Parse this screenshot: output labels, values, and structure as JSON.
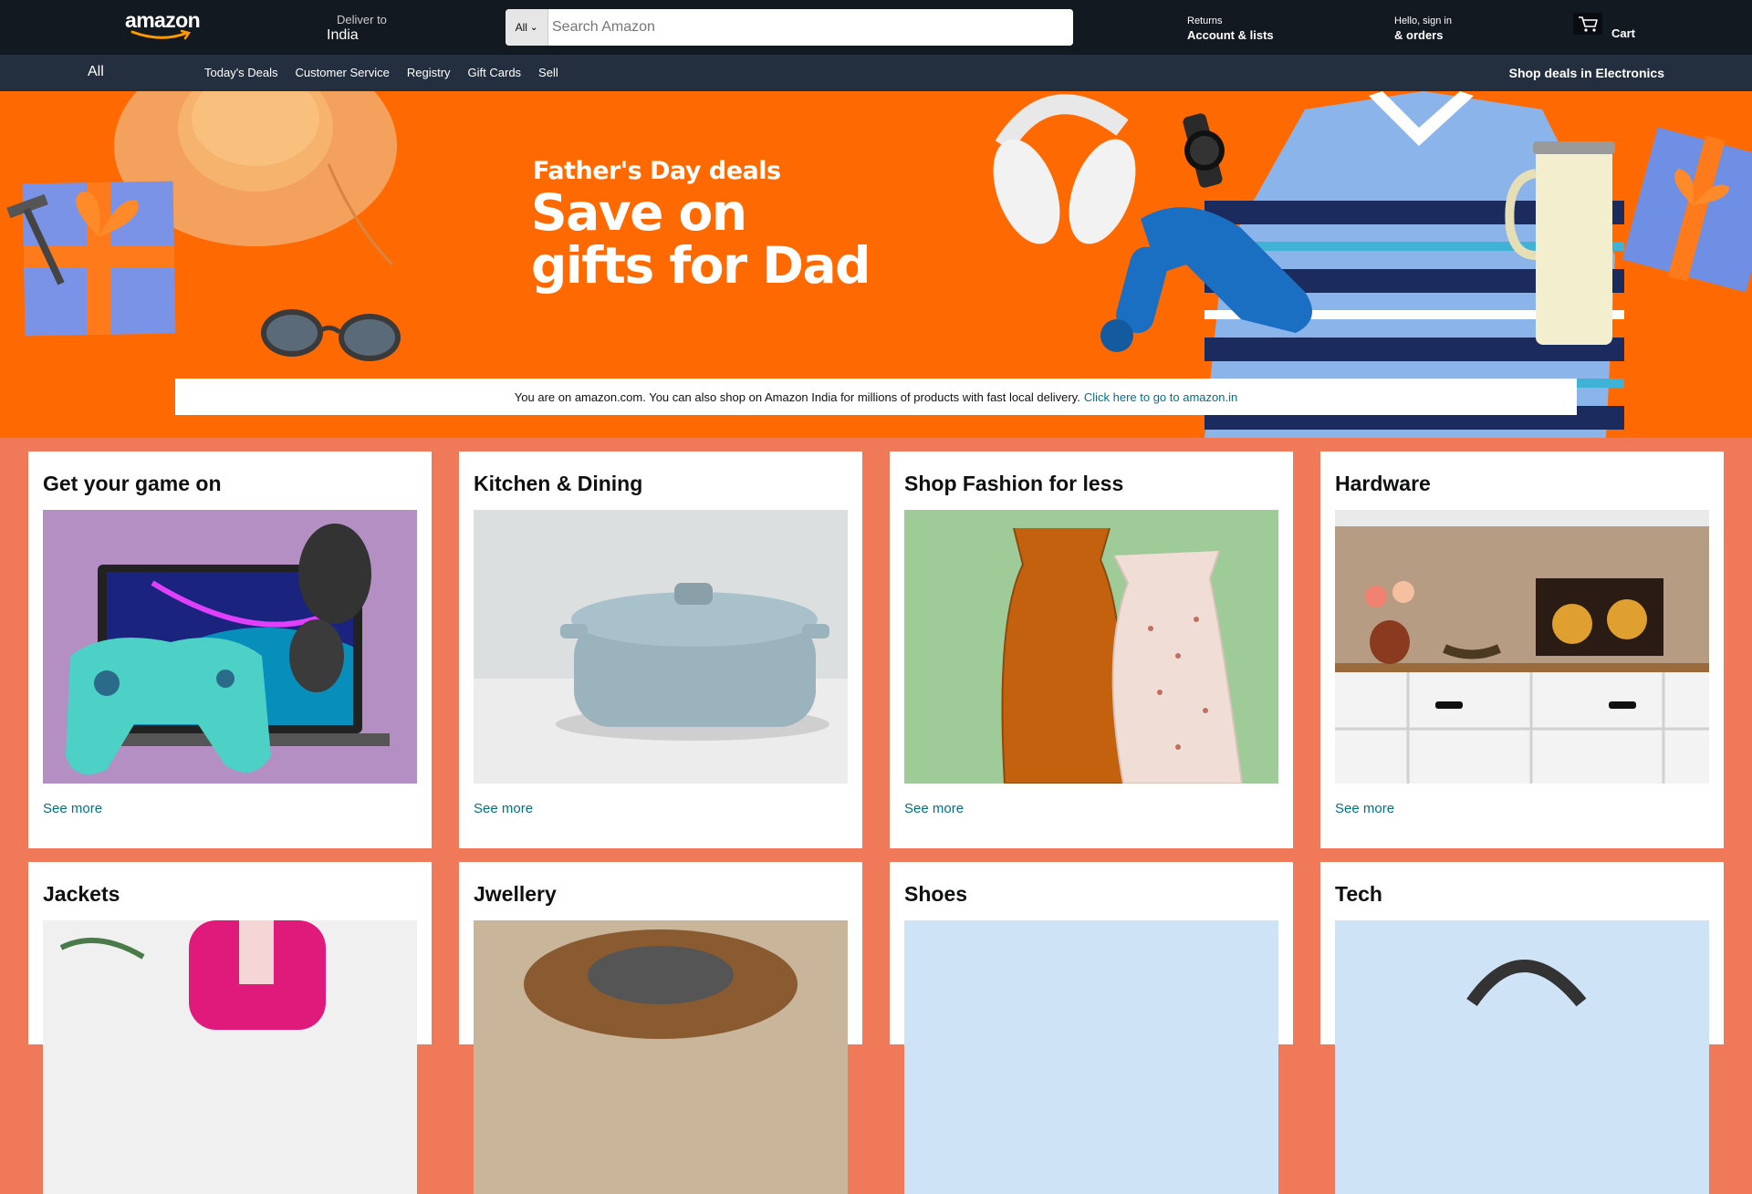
{
  "header": {
    "logo_text": "amazon",
    "deliver_to_label": "Deliver to",
    "deliver_to_location": "India",
    "search_category": "All",
    "search_placeholder": "Search Amazon",
    "returns_label": "Returns",
    "account_label": "Account & lists",
    "signin_label": "Hello, sign in",
    "orders_label": "& orders",
    "cart_label": "Cart",
    "cart_icon": "cart-icon"
  },
  "subnav": {
    "all_label": "All",
    "items": [
      "Today's Deals",
      "Customer Service",
      "Registry",
      "Gift Cards",
      "Sell"
    ],
    "promo": "Shop deals in Electronics"
  },
  "hero": {
    "kicker": "Father's Day deals",
    "headline": "Save on gifts for Dad",
    "background_color": "#fe6a01"
  },
  "notice": {
    "text": "You are on amazon.com. You can also shop on Amazon India for millions of products with fast local delivery.",
    "link": "Click here to go to amazon.in"
  },
  "cards": [
    {
      "title": "Get your game on",
      "link": "See more",
      "image": "gaming-laptop-controller-headphones"
    },
    {
      "title": "Kitchen & Dining",
      "link": "See more",
      "image": "dutch-oven-pot"
    },
    {
      "title": "Shop Fashion for less",
      "link": "See more",
      "image": "dresses-on-wall"
    },
    {
      "title": "Hardware",
      "link": "See more",
      "image": "kitchen-cabinets"
    },
    {
      "title": "Jackets",
      "link": "",
      "image": "pink-jacket"
    },
    {
      "title": "Jwellery",
      "link": "",
      "image": "jewellery"
    },
    {
      "title": "Shoes",
      "link": "",
      "image": "shoes"
    },
    {
      "title": "Tech",
      "link": "",
      "image": "headphones-tech"
    }
  ],
  "colors": {
    "header_bg": "#131921",
    "subnav_bg": "#232f3e",
    "page_bg": "#f0795a",
    "link": "#007185"
  }
}
